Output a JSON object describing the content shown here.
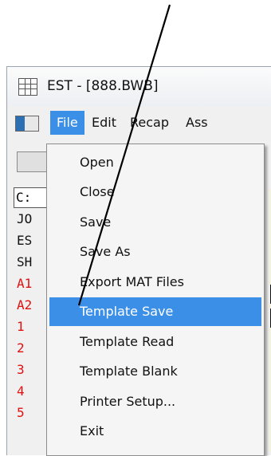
{
  "window": {
    "title": "EST - [888.BWB]"
  },
  "menubar": {
    "items": [
      {
        "label": "File",
        "active": true
      },
      {
        "label": "Edit"
      },
      {
        "label": "Recap"
      },
      {
        "label": "Ass"
      }
    ]
  },
  "background": {
    "drive_box": "C:",
    "rows": [
      "JO",
      "ES",
      "SH",
      "A1",
      "A2",
      "1",
      "2",
      "3",
      "4",
      "5"
    ]
  },
  "file_menu": {
    "items": [
      {
        "label": "Open"
      },
      {
        "label": "Close"
      },
      {
        "label": "Save"
      },
      {
        "label": "Save As"
      },
      {
        "label": "Export MAT Files"
      },
      {
        "label": "Template Save",
        "highlighted": true
      },
      {
        "label": "Template Read"
      },
      {
        "label": "Template Blank"
      },
      {
        "label": "Printer Setup..."
      },
      {
        "label": "Exit"
      }
    ]
  },
  "colors": {
    "accent": "#3c8fe6",
    "red_text": "#e01010",
    "menu_bg": "#f5f5f5"
  }
}
